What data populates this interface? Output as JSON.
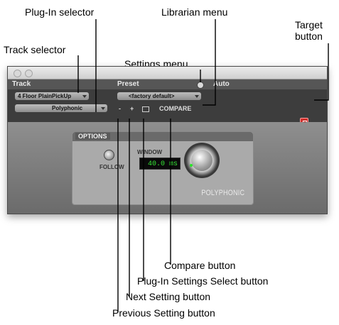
{
  "callouts": {
    "plugin_selector": "Plug-In selector",
    "librarian_menu": "Librarian menu",
    "target_button": "Target\nbutton",
    "track_selector": "Track selector",
    "settings_menu": "Settings menu",
    "compare_button": "Compare button",
    "plugin_settings_select_button": "Plug-In Settings Select button",
    "next_setting_button": "Next Setting button",
    "previous_setting_button": "Previous Setting button"
  },
  "window": {
    "header": {
      "track": "Track",
      "preset": "Preset",
      "auto": "Auto"
    },
    "track_name": "4 Floor PlainPickUp",
    "plugin_name": "Polyphonic",
    "preset_value": "<factory default>",
    "prev_symbol": "-",
    "next_symbol": "+",
    "compare_label": "COMPARE",
    "options_tab": "OPTIONS",
    "follow_label": "FOLLOW",
    "window_label": "WINDOW",
    "window_value": "40.0 ms",
    "brand": "POLYPHONIC"
  },
  "colors": {
    "target": "#d0302d",
    "lcd_text": "#36e636",
    "window_bg": "#6f6f6f"
  },
  "icons": [
    "target-icon",
    "settings-icon",
    "folder-icon",
    "follow-icon",
    "knob-icon"
  ]
}
